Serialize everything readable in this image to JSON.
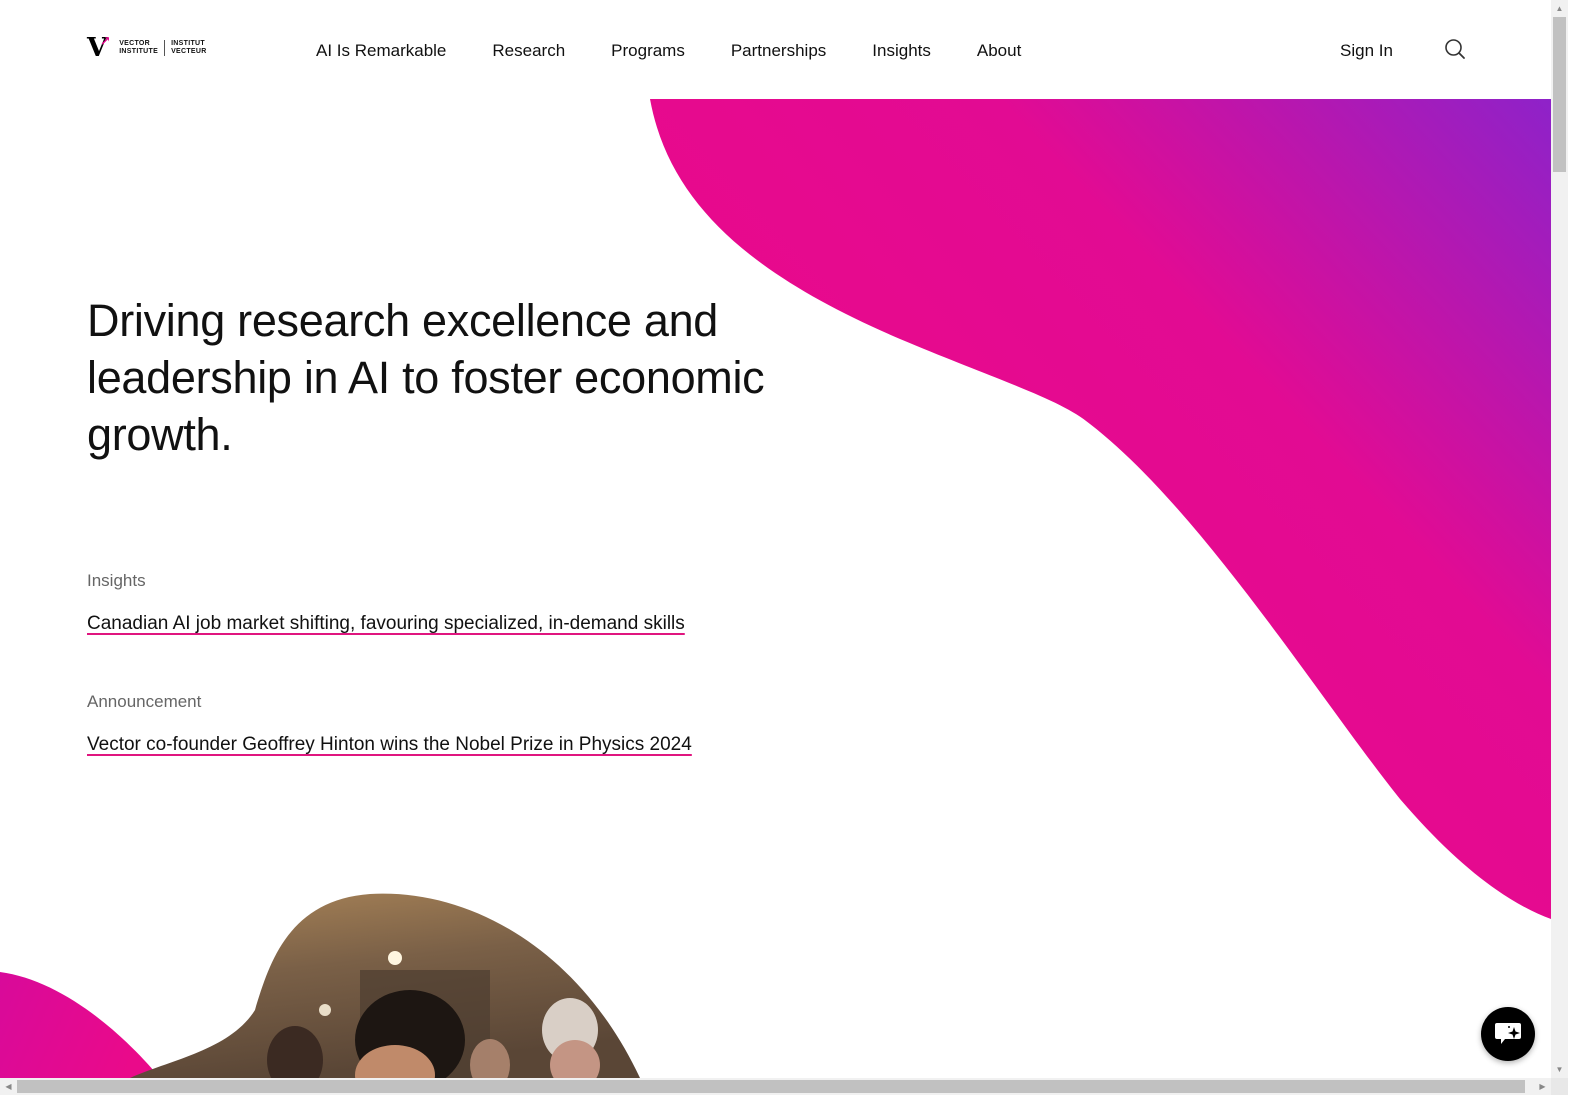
{
  "brand": {
    "logo_mark": "V",
    "name_en_line1": "VECTOR",
    "name_en_line2": "INSTITUTE",
    "name_fr_line1": "INSTITUT",
    "name_fr_line2": "VECTEUR",
    "accent_color": "#e5008b",
    "gradient_colors": [
      "#e8098c",
      "#8e22c9"
    ]
  },
  "nav": {
    "items": [
      {
        "label": "AI Is Remarkable"
      },
      {
        "label": "Research"
      },
      {
        "label": "Programs"
      },
      {
        "label": "Partnerships"
      },
      {
        "label": "Insights"
      },
      {
        "label": "About"
      }
    ],
    "sign_in": "Sign In",
    "search_icon": "search-icon"
  },
  "hero": {
    "title": "Driving research excellence and leadership in AI to foster economic growth."
  },
  "news": [
    {
      "kicker": "Insights",
      "headline": "Canadian AI job market shifting, favouring specialized, in-demand skills"
    },
    {
      "kicker": "Announcement",
      "headline": "Vector co-founder Geoffrey Hinton wins the Nobel Prize in Physics 2024"
    }
  ],
  "chat": {
    "icon": "chat-sparkle-icon"
  },
  "scrollbars": {
    "vertical": "vertical-scrollbar",
    "horizontal": "horizontal-scrollbar"
  }
}
